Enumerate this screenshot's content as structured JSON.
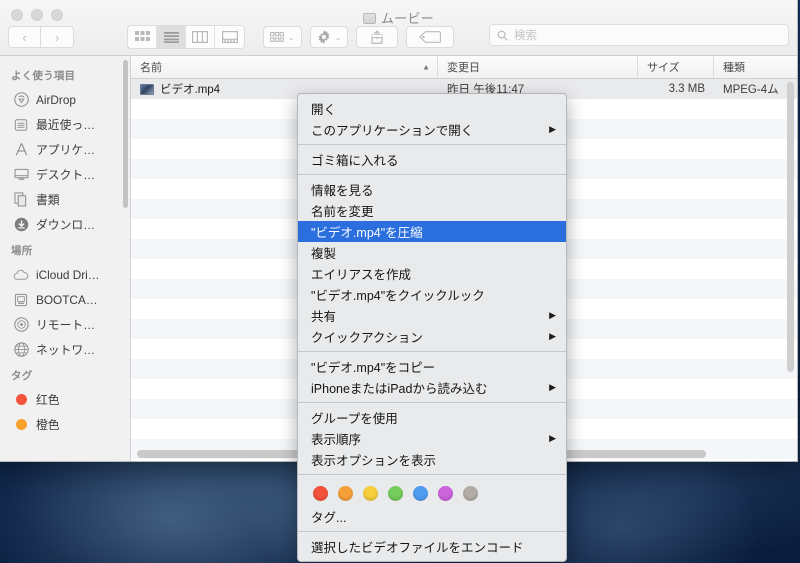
{
  "window": {
    "title": "ムービー",
    "title_icon": "folder-icon"
  },
  "toolbar": {
    "back_glyph": "‹",
    "forward_glyph": "›",
    "view_modes": [
      {
        "name": "icon-view",
        "active": false
      },
      {
        "name": "list-view",
        "active": true
      },
      {
        "name": "column-view",
        "active": false
      },
      {
        "name": "gallery-view",
        "active": false
      }
    ],
    "arrange_icon": "grid-icon",
    "action_icon": "gear-icon",
    "share_icon": "share-icon",
    "tag_icon": "tag-icon",
    "chevron": "⌄"
  },
  "search": {
    "icon": "search-icon",
    "placeholder": "検索",
    "value": ""
  },
  "sidebar": {
    "sections": [
      {
        "header": "よく使う項目",
        "items": [
          {
            "label": "AirDrop",
            "icon": "airdrop-icon"
          },
          {
            "label": "最近使っ…",
            "icon": "recents-icon"
          },
          {
            "label": "アプリケ…",
            "icon": "applications-icon"
          },
          {
            "label": "デスクト…",
            "icon": "desktop-icon"
          },
          {
            "label": "書類",
            "icon": "documents-icon"
          },
          {
            "label": "ダウンロ…",
            "icon": "downloads-icon"
          }
        ]
      },
      {
        "header": "場所",
        "items": [
          {
            "label": "iCloud Dri…",
            "icon": "icloud-icon"
          },
          {
            "label": "BOOTCA…",
            "icon": "harddisk-icon"
          },
          {
            "label": "リモート…",
            "icon": "remotedisc-icon"
          },
          {
            "label": "ネットワ…",
            "icon": "network-icon"
          }
        ]
      },
      {
        "header": "タグ",
        "items": [
          {
            "label": "红色",
            "icon": "red-dot-icon",
            "color": "#f4533c"
          },
          {
            "label": "橙色",
            "icon": "orange-dot-icon",
            "color": "#f8a02c"
          }
        ]
      }
    ]
  },
  "file_list": {
    "columns": [
      {
        "label": "名前",
        "sorted": true,
        "sort_glyph": "▲"
      },
      {
        "label": "変更日",
        "sorted": false
      },
      {
        "label": "サイズ",
        "sorted": false
      },
      {
        "label": "種類",
        "sorted": false
      }
    ],
    "rows": [
      {
        "name": "ビデオ.mp4",
        "date": "昨日 午後11:47",
        "size": "3.3 MB",
        "kind": "MPEG-4ム",
        "selected": true,
        "icon": "video-file-icon"
      }
    ]
  },
  "context_menu": {
    "groups": [
      {
        "items": [
          {
            "label": "開く",
            "submenu": false,
            "highlighted": false
          },
          {
            "label": "このアプリケーションで開く",
            "submenu": true,
            "highlighted": false
          }
        ]
      },
      {
        "items": [
          {
            "label": "ゴミ箱に入れる",
            "submenu": false,
            "highlighted": false
          }
        ]
      },
      {
        "items": [
          {
            "label": "情報を見る",
            "submenu": false,
            "highlighted": false
          },
          {
            "label": "名前を変更",
            "submenu": false,
            "highlighted": false
          },
          {
            "label": "\"ビデオ.mp4\"を圧縮",
            "submenu": false,
            "highlighted": true
          },
          {
            "label": "複製",
            "submenu": false,
            "highlighted": false
          },
          {
            "label": "エイリアスを作成",
            "submenu": false,
            "highlighted": false
          },
          {
            "label": "\"ビデオ.mp4\"をクイックルック",
            "submenu": false,
            "highlighted": false
          },
          {
            "label": "共有",
            "submenu": true,
            "highlighted": false
          },
          {
            "label": "クイックアクション",
            "submenu": true,
            "highlighted": false
          }
        ]
      },
      {
        "items": [
          {
            "label": "\"ビデオ.mp4\"をコピー",
            "submenu": false,
            "highlighted": false
          },
          {
            "label": "iPhoneまたはiPadから読み込む",
            "submenu": true,
            "highlighted": false
          }
        ]
      },
      {
        "items": [
          {
            "label": "グループを使用",
            "submenu": false,
            "highlighted": false
          },
          {
            "label": "表示順序",
            "submenu": true,
            "highlighted": false
          },
          {
            "label": "表示オプションを表示",
            "submenu": false,
            "highlighted": false
          }
        ]
      },
      {
        "tag_dots": [
          "#f4533c",
          "#f6a03a",
          "#f6cf3c",
          "#74cc5a",
          "#4f9cf0",
          "#cd63dd",
          "#b2ada5"
        ],
        "items": [
          {
            "label": "タグ...",
            "submenu": false,
            "highlighted": false
          }
        ]
      },
      {
        "items": [
          {
            "label": "選択したビデオファイルをエンコード",
            "submenu": false,
            "highlighted": false
          }
        ]
      }
    ],
    "submenu_arrow": "▶",
    "highlight_color": "#2b6fdf"
  }
}
